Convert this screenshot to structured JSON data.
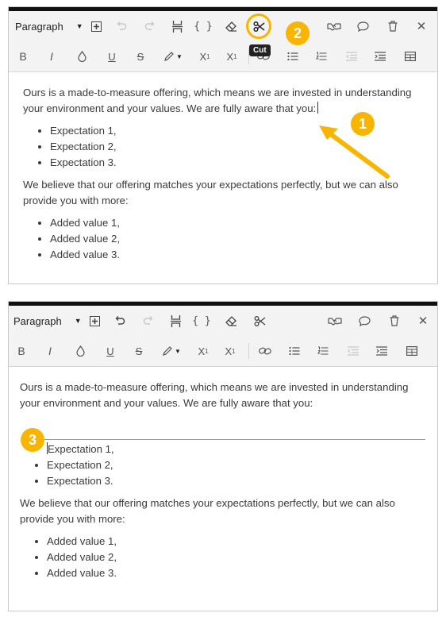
{
  "colors": {
    "accent": "#f7b500",
    "toolbar_bg": "#f3f3f3",
    "text": "#3a3a3a"
  },
  "annotations": {
    "step1": "1",
    "step2": "2",
    "step3": "3",
    "tooltip_cut": "Cut"
  },
  "before": {
    "toolbar": {
      "paragraph_label": "Paragraph",
      "row1_icons": [
        "insert-block-icon",
        "undo-icon",
        "redo-icon",
        "page-break-icon",
        "code-braces-icon",
        "eraser-icon",
        "scissors-icon",
        "handshake-icon",
        "comment-icon",
        "trash-icon",
        "close-icon"
      ],
      "row2_icons": [
        "bold-icon",
        "italic-icon",
        "ink-drop-icon",
        "underline-icon",
        "strikethrough-icon",
        "highlighter-icon",
        "superscript-icon",
        "subscript-icon",
        "link-icon",
        "bullet-list-icon",
        "numbered-list-icon",
        "outdent-icon",
        "indent-icon",
        "table-icon"
      ],
      "b_label": "B",
      "i_label": "I",
      "u_label": "U",
      "s_label": "S",
      "sup_label": "X",
      "sup_mark": "1",
      "sub_label": "X",
      "sub_mark": "1"
    },
    "content": {
      "p1": "Ours is a made-to-measure offering, which means we are invested in understanding your environment and your values. We are fully aware that you:",
      "list1": [
        "Expectation 1,",
        "Expectation 2,",
        "Expectation 3."
      ],
      "p2": "We believe that our offering matches your expectations perfectly, but we can also provide you with more:",
      "list2": [
        "Added value 1,",
        "Added value 2,",
        "Added value 3."
      ]
    }
  },
  "after": {
    "toolbar": {
      "paragraph_label": "Paragraph"
    },
    "content": {
      "p1": "Ours is a made-to-measure offering, which means we are invested in understanding your environment and your values. We are fully aware that you:",
      "list1": [
        "Expectation 1,",
        "Expectation 2,",
        "Expectation 3."
      ],
      "p2": "We believe that our offering matches your expectations perfectly, but we can also provide you with more:",
      "list2": [
        "Added value 1,",
        "Added value 2,",
        "Added value 3."
      ]
    }
  }
}
